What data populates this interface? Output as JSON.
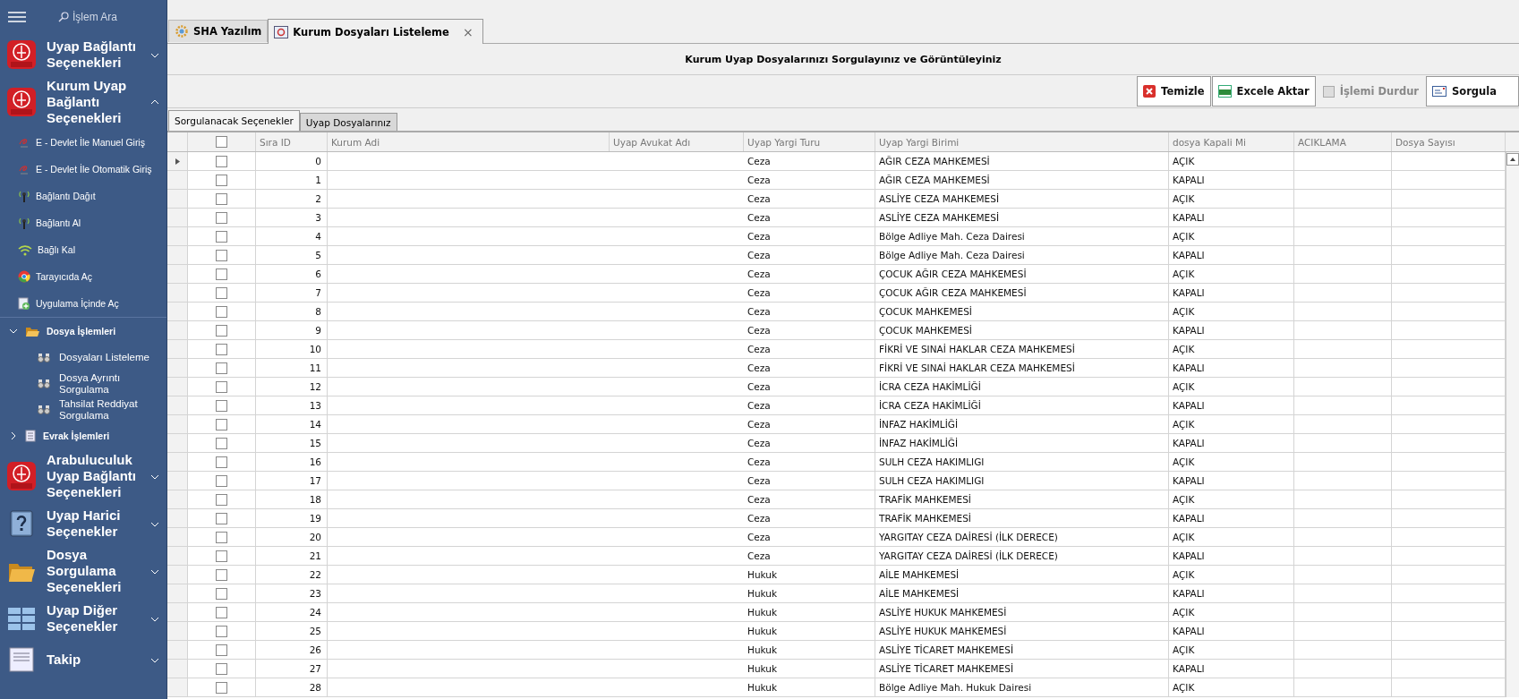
{
  "sidebar": {
    "search": {
      "placeholder": "İşlem Ara"
    },
    "groups": [
      {
        "title": "Uyap Bağlantı Seçenekleri",
        "expanded": false
      },
      {
        "title": "Kurum Uyap Bağlantı Seçenekleri",
        "expanded": true,
        "children": [
          {
            "label": "E - Devlet İle Manuel Giriş"
          },
          {
            "label": "E - Devlet İle Otomatik Giriş"
          },
          {
            "label": "Bağlantı Dağıt"
          },
          {
            "label": "Bağlantı Al"
          },
          {
            "label": "Bağlı Kal"
          },
          {
            "label": "Tarayıcıda Aç"
          },
          {
            "label": "Uygulama İçinde Aç"
          },
          {
            "label": "Dosya İşlemleri",
            "expanded": true,
            "children": [
              {
                "label": "Dosyaları Listeleme"
              },
              {
                "label": "Dosya Ayrıntı Sorgulama"
              },
              {
                "label": "Tahsilat Reddiyat Sorgulama"
              }
            ]
          },
          {
            "label": "Evrak İşlemleri",
            "expanded": false
          }
        ]
      },
      {
        "title": "Arabuluculuk Uyap Bağlantı Seçenekleri",
        "expanded": false
      },
      {
        "title": "Uyap Harici Seçenekler",
        "expanded": false
      },
      {
        "title": "Dosya Sorgulama Seçenekleri",
        "expanded": false
      },
      {
        "title": "Uyap Diğer Seçenekler",
        "expanded": false
      },
      {
        "title": "Takip",
        "expanded": false
      }
    ]
  },
  "tabs": [
    {
      "label": "SHA Yazılım",
      "selected": false
    },
    {
      "label": "Kurum Dosyaları Listeleme",
      "selected": true,
      "close": "×"
    }
  ],
  "heading": "Kurum Uyap Dosyalarınızı Sorgulayınız ve Görüntüleyiniz",
  "buttons": [
    {
      "label": "Temizle",
      "disabled": false
    },
    {
      "label": "Excele Aktar",
      "disabled": false
    },
    {
      "label": "İşlemi Durdur",
      "disabled": true
    },
    {
      "label": "Sorgula",
      "disabled": false
    }
  ],
  "subtabs": [
    {
      "label": "Sorgulanacak Seçenekler",
      "selected": true
    },
    {
      "label": "Uyap Dosyalarınız",
      "selected": false
    }
  ],
  "table": {
    "header_checked": false,
    "columns": [
      "Sıra ID",
      "Kurum Adi",
      "Uyap Avukat Adı",
      "Uyap Yargi Turu",
      "Uyap Yargi Birimi",
      "dosya Kapali Mi",
      "ACIKLAMA",
      "Dosya Sayısı"
    ],
    "rows": [
      {
        "current": true,
        "checked": false,
        "id": "0",
        "turu": "Ceza",
        "birim": "AĞIR CEZA MAHKEMESİ",
        "kapali": "AÇIK"
      },
      {
        "current": false,
        "checked": false,
        "id": "1",
        "turu": "Ceza",
        "birim": "AĞIR CEZA MAHKEMESİ",
        "kapali": "KAPALI"
      },
      {
        "current": false,
        "checked": false,
        "id": "2",
        "turu": "Ceza",
        "birim": "ASLİYE CEZA MAHKEMESİ",
        "kapali": "AÇIK"
      },
      {
        "current": false,
        "checked": false,
        "id": "3",
        "turu": "Ceza",
        "birim": "ASLİYE CEZA MAHKEMESİ",
        "kapali": "KAPALI"
      },
      {
        "current": false,
        "checked": false,
        "id": "4",
        "turu": "Ceza",
        "birim": "Bölge Adliye Mah. Ceza Dairesi",
        "kapali": "AÇIK"
      },
      {
        "current": false,
        "checked": false,
        "id": "5",
        "turu": "Ceza",
        "birim": "Bölge Adliye Mah. Ceza Dairesi",
        "kapali": "KAPALI"
      },
      {
        "current": false,
        "checked": false,
        "id": "6",
        "turu": "Ceza",
        "birim": "ÇOCUK AĞIR CEZA MAHKEMESİ",
        "kapali": "AÇIK"
      },
      {
        "current": false,
        "checked": false,
        "id": "7",
        "turu": "Ceza",
        "birim": "ÇOCUK AĞIR CEZA MAHKEMESİ",
        "kapali": "KAPALI"
      },
      {
        "current": false,
        "checked": false,
        "id": "8",
        "turu": "Ceza",
        "birim": "ÇOCUK MAHKEMESİ",
        "kapali": "AÇIK"
      },
      {
        "current": false,
        "checked": false,
        "id": "9",
        "turu": "Ceza",
        "birim": "ÇOCUK MAHKEMESİ",
        "kapali": "KAPALI"
      },
      {
        "current": false,
        "checked": false,
        "id": "10",
        "turu": "Ceza",
        "birim": "FİKRİ VE SINAİ HAKLAR CEZA MAHKEMESİ",
        "kapali": "AÇIK"
      },
      {
        "current": false,
        "checked": false,
        "id": "11",
        "turu": "Ceza",
        "birim": "FİKRİ VE SINAİ HAKLAR CEZA MAHKEMESİ",
        "kapali": "KAPALI"
      },
      {
        "current": false,
        "checked": false,
        "id": "12",
        "turu": "Ceza",
        "birim": "İCRA CEZA HAKİMLİĞİ",
        "kapali": "AÇIK"
      },
      {
        "current": false,
        "checked": false,
        "id": "13",
        "turu": "Ceza",
        "birim": "İCRA CEZA HAKİMLİĞİ",
        "kapali": "KAPALI"
      },
      {
        "current": false,
        "checked": false,
        "id": "14",
        "turu": "Ceza",
        "birim": "İNFAZ HAKİMLİĞİ",
        "kapali": "AÇIK"
      },
      {
        "current": false,
        "checked": false,
        "id": "15",
        "turu": "Ceza",
        "birim": "İNFAZ HAKİMLİĞİ",
        "kapali": "KAPALI"
      },
      {
        "current": false,
        "checked": false,
        "id": "16",
        "turu": "Ceza",
        "birim": "SULH CEZA HAKIMLIGI",
        "kapali": "AÇIK"
      },
      {
        "current": false,
        "checked": false,
        "id": "17",
        "turu": "Ceza",
        "birim": "SULH CEZA HAKIMLIGI",
        "kapali": "KAPALI"
      },
      {
        "current": false,
        "checked": false,
        "id": "18",
        "turu": "Ceza",
        "birim": "TRAFİK MAHKEMESİ",
        "kapali": "AÇIK"
      },
      {
        "current": false,
        "checked": false,
        "id": "19",
        "turu": "Ceza",
        "birim": "TRAFİK MAHKEMESİ",
        "kapali": "KAPALI"
      },
      {
        "current": false,
        "checked": false,
        "id": "20",
        "turu": "Ceza",
        "birim": "YARGITAY CEZA DAİRESİ (İLK DERECE)",
        "kapali": "AÇIK"
      },
      {
        "current": false,
        "checked": false,
        "id": "21",
        "turu": "Ceza",
        "birim": "YARGITAY CEZA DAİRESİ (İLK DERECE)",
        "kapali": "KAPALI"
      },
      {
        "current": false,
        "checked": false,
        "id": "22",
        "turu": "Hukuk",
        "birim": "AİLE MAHKEMESİ",
        "kapali": "AÇIK"
      },
      {
        "current": false,
        "checked": false,
        "id": "23",
        "turu": "Hukuk",
        "birim": "AİLE MAHKEMESİ",
        "kapali": "KAPALI"
      },
      {
        "current": false,
        "checked": false,
        "id": "24",
        "turu": "Hukuk",
        "birim": "ASLİYE HUKUK MAHKEMESİ",
        "kapali": "AÇIK"
      },
      {
        "current": false,
        "checked": false,
        "id": "25",
        "turu": "Hukuk",
        "birim": "ASLİYE HUKUK MAHKEMESİ",
        "kapali": "KAPALI"
      },
      {
        "current": false,
        "checked": false,
        "id": "26",
        "turu": "Hukuk",
        "birim": "ASLİYE TİCARET MAHKEMESİ",
        "kapali": "AÇIK"
      },
      {
        "current": false,
        "checked": false,
        "id": "27",
        "turu": "Hukuk",
        "birim": "ASLİYE TİCARET MAHKEMESİ",
        "kapali": "KAPALI"
      },
      {
        "current": false,
        "checked": false,
        "id": "28",
        "turu": "Hukuk",
        "birim": "Bölge Adliye Mah. Hukuk Dairesi",
        "kapali": "AÇIK"
      }
    ]
  }
}
